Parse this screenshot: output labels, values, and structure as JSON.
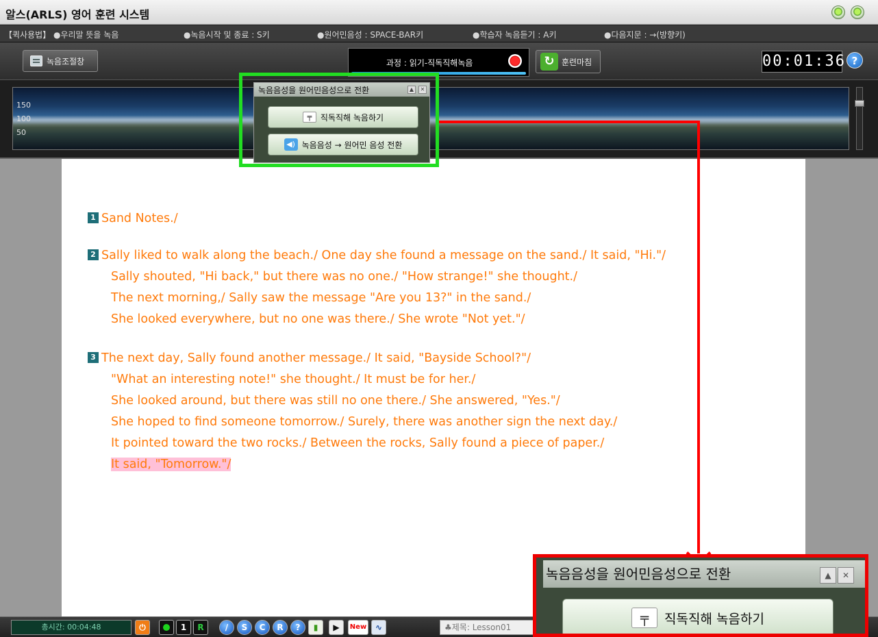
{
  "window": {
    "title": "알스(ARLS) 영어 훈련 시스템"
  },
  "hints": [
    "【퀵사용법】 ●우리말 뜻을 녹음",
    "●녹음시작 및 종료 : S키",
    "●원어민음성 : SPACE-BAR키",
    "●학습자 녹음듣기 : A키",
    "●다음지문 : →(방향키)"
  ],
  "toolbar": {
    "rec_adjust_label": "녹음조절창",
    "process_label": "과정 : 읽기-직독직해녹음",
    "train_end_label": "훈련마침",
    "timer": "00:01:36",
    "help_label": "?"
  },
  "waveform": {
    "ylabels": [
      "150",
      "100",
      "50"
    ]
  },
  "popup": {
    "title": "녹음음성을 원어민음성으로 전환",
    "btn_record": "직독직해 녹음하기",
    "btn_convert": "녹음음성 → 원어민 음성 전환"
  },
  "reading": {
    "paragraphs": [
      {
        "num": "1",
        "lines": [
          "Sand Notes./"
        ]
      },
      {
        "num": "2",
        "lines": [
          "Sally liked to walk along the beach./ One day she found a message on the sand./ It said, \"Hi.\"/",
          "Sally shouted, \"Hi back,\" but there was no one./ \"How strange!\" she thought./",
          "The next morning,/ Sally saw the message \"Are you 13?\" in the sand./",
          "She looked everywhere, but no one was there./ She wrote \"Not yet.\"/"
        ]
      },
      {
        "num": "3",
        "lines": [
          "The next day, Sally found another message./ It said, \"Bayside School?\"/",
          "\"What an interesting note!\" she thought./ It must be for her./",
          "She looked around, but there was still no one there./ She answered, \"Yes.\"/",
          "She hoped to find someone tomorrow./ Surely, there was another sign the next day./",
          "It pointed toward the two rocks./ Between the rocks, Sally found a piece of paper./",
          "It said, \"Tomorrow.\"/"
        ]
      }
    ]
  },
  "statusbar": {
    "total_time": "총시간: 00:04:48",
    "btn_1": "1",
    "btn_r": "R",
    "btn_s": "S",
    "btn_c": "C",
    "btn_r2": "R",
    "btn_q": "?",
    "btn_new": "New",
    "lesson": "♣제목: Lesson01"
  },
  "zoom": {
    "title": "녹음음성을 원어민음성으로 전환",
    "btn_record": "직독직해 녹음하기"
  },
  "colors": {
    "highlight_green": "#22dd22",
    "highlight_red": "#ee0000",
    "text_orange": "#ff7a0a",
    "sentence_highlight": "#ffc0d8"
  }
}
